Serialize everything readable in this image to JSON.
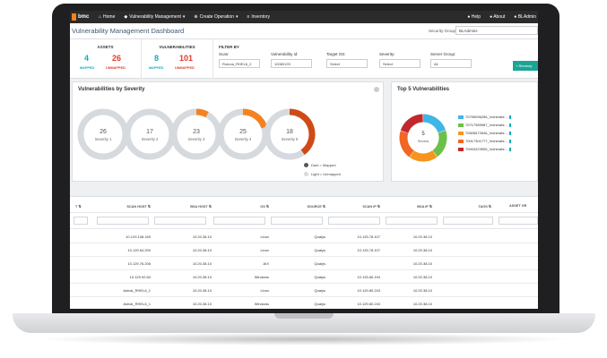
{
  "topbar": {
    "brand": "bmc",
    "nav": [
      {
        "label": "Home",
        "icon": "home-icon"
      },
      {
        "label": "Vulnerability Management",
        "icon": "shield-icon"
      },
      {
        "label": "Create Operation",
        "icon": "plus-circle-icon"
      },
      {
        "label": "Inventory",
        "icon": "list-icon"
      }
    ],
    "right": [
      "Help",
      "About",
      "BLAdmin"
    ]
  },
  "titlebar": {
    "title": "Vulnerability Management Dashboard",
    "security_groups_label": "Security Groups:",
    "security_groups_value": "BLAdmins"
  },
  "summary": {
    "assets": {
      "title": "ASSETS",
      "mapped": "4",
      "mapped_label": "MAPPED",
      "unmapped": "26",
      "unmapped_label": "UNMAPPED"
    },
    "vulnerabilities": {
      "title": "VULNERABILITIES",
      "mapped": "8",
      "mapped_label": "MAPPED",
      "unmapped": "101",
      "unmapped_label": "UNMAPPED"
    }
  },
  "filter": {
    "title": "FILTER BY",
    "fields": [
      {
        "label": "Scan:",
        "value": "Rutuna_RHEL6_2"
      },
      {
        "label": "Vulnerability id:",
        "value": "10080193"
      },
      {
        "label": "Target OS:",
        "value": "Select"
      },
      {
        "label": "Severity:",
        "value": "Select"
      },
      {
        "label": "Server Group:",
        "value": "All"
      }
    ],
    "remedy_label": "+ Remedy"
  },
  "severity_panel": {
    "title": "Vulnerabilities by Severity",
    "donuts": [
      {
        "count": "26",
        "label": "Severity 1",
        "mapped_fraction": 0.0
      },
      {
        "count": "17",
        "label": "Severity 2",
        "mapped_fraction": 0.0
      },
      {
        "count": "23",
        "label": "Severity 3",
        "mapped_fraction": 0.08
      },
      {
        "count": "25",
        "label": "Severity 4",
        "mapped_fraction": 0.2
      },
      {
        "count": "18",
        "label": "Severity 5",
        "mapped_fraction": 0.4
      }
    ],
    "legend": {
      "mapped": "Dark = Mapped",
      "unmapped": "Light = Unmapped"
    }
  },
  "top5_panel": {
    "title": "Top 5 Vulnerabilities",
    "center_count": "5",
    "center_label": "Severs",
    "items": [
      {
        "label": "70755096256_Vulnerabi...",
        "color": "#41b6e6"
      },
      {
        "label": "70717989987_Vulnerabi...",
        "color": "#6cc04a"
      },
      {
        "label": "70826672646_Vulnerabi...",
        "color": "#f7941d"
      },
      {
        "label": "70017301777_Vulnerabi...",
        "color": "#f26522"
      },
      {
        "label": "70004223905_Vulnerabi...",
        "color": "#c1272d"
      }
    ]
  },
  "table": {
    "headers": [
      "T",
      "SCAN HOST",
      "BSA HOST",
      "OS",
      "SOURCE",
      "SCAN IP",
      "BSA IP",
      "TAGS",
      "ASSET GR"
    ],
    "rows": [
      [
        "10.129.108.169",
        "10.20.38.10",
        "Linux",
        "Qualys",
        "10.133.78.107",
        "10.20.38.10"
      ],
      [
        "10.129.54.200",
        "10.20.38.10",
        "Linux",
        "Qualys",
        "10.133.78.107",
        "10.20.38.10"
      ],
      [
        "10.129.76.206",
        "10.20.38.10",
        "AIX",
        "Qualys",
        "",
        "10.20.38.10"
      ],
      [
        "10.129.92.84",
        "10.20.38.10",
        "Windows",
        "Qualys",
        "10.133.66.194",
        "10.20.38.10"
      ],
      [
        "Ashok_RHEL6_1",
        "10.20.38.10",
        "Linux",
        "Qualys",
        "10.129.80.243",
        "10.20.38.10"
      ],
      [
        "Ashok_RHEL6_1",
        "10.20.38.10",
        "Windows",
        "Qualys",
        "10.129.80.243",
        "10.20.38.10"
      ]
    ]
  },
  "colors": {
    "accent_teal": "#17a9b5",
    "alert_red": "#e0392c",
    "mapped_dark": "#d04a17",
    "mapped_orange": "#f58220",
    "unmapped_light": "#d6dadf"
  }
}
